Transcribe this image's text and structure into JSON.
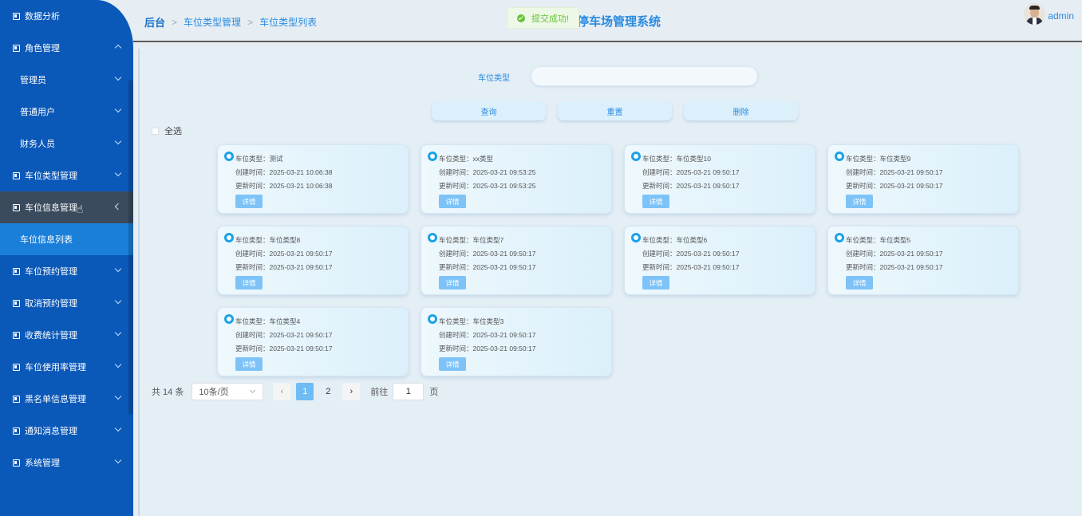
{
  "sidebar": {
    "items": [
      {
        "label": "数据分析",
        "kind": "top",
        "chevron": "none"
      },
      {
        "label": "角色管理",
        "kind": "top",
        "chevron": "up"
      },
      {
        "label": "管理员",
        "kind": "sub",
        "chevron": "down"
      },
      {
        "label": "普通用户",
        "kind": "sub",
        "chevron": "down"
      },
      {
        "label": "财务人员",
        "kind": "sub",
        "chevron": "down"
      },
      {
        "label": "车位类型管理",
        "kind": "top",
        "chevron": "down"
      },
      {
        "label": "车位信息管理",
        "kind": "top-dark",
        "chevron": "left"
      },
      {
        "label": "车位信息列表",
        "kind": "active-sub",
        "chevron": "none"
      },
      {
        "label": "车位预约管理",
        "kind": "top",
        "chevron": "down"
      },
      {
        "label": "取消预约管理",
        "kind": "top",
        "chevron": "down"
      },
      {
        "label": "收费统计管理",
        "kind": "top",
        "chevron": "down"
      },
      {
        "label": "车位使用率管理",
        "kind": "top",
        "chevron": "down"
      },
      {
        "label": "黑名单信息管理",
        "kind": "top",
        "chevron": "down"
      },
      {
        "label": "通知消息管理",
        "kind": "top",
        "chevron": "down"
      },
      {
        "label": "系统管理",
        "kind": "top",
        "chevron": "down"
      }
    ]
  },
  "header": {
    "breadcrumb": [
      "后台",
      "车位类型管理",
      "车位类型列表"
    ],
    "system_title": "停车场管理系统",
    "toast": "提交成功!",
    "username": "admin"
  },
  "search": {
    "label": "车位类型",
    "value": "",
    "placeholder": ""
  },
  "buttons": {
    "query": "查询",
    "reset": "重置",
    "delete": "删除"
  },
  "select_all": "全选",
  "card_labels": {
    "type": "车位类型：",
    "created": "创建时间：",
    "updated": "更新时间：",
    "detail": "详情"
  },
  "cards": [
    {
      "type": "测试",
      "created": "2025-03-21 10:06:38",
      "updated": "2025-03-21 10:06:38"
    },
    {
      "type": "xx类型",
      "created": "2025-03-21 09:53:25",
      "updated": "2025-03-21 09:53:25"
    },
    {
      "type": "车位类型10",
      "created": "2025-03-21 09:50:17",
      "updated": "2025-03-21 09:50:17"
    },
    {
      "type": "车位类型9",
      "created": "2025-03-21 09:50:17",
      "updated": "2025-03-21 09:50:17"
    },
    {
      "type": "车位类型8",
      "created": "2025-03-21 09:50:17",
      "updated": "2025-03-21 09:50:17"
    },
    {
      "type": "车位类型7",
      "created": "2025-03-21 09:50:17",
      "updated": "2025-03-21 09:50:17"
    },
    {
      "type": "车位类型6",
      "created": "2025-03-21 09:50:17",
      "updated": "2025-03-21 09:50:17"
    },
    {
      "type": "车位类型5",
      "created": "2025-03-21 09:50:17",
      "updated": "2025-03-21 09:50:17"
    },
    {
      "type": "车位类型4",
      "created": "2025-03-21 09:50:17",
      "updated": "2025-03-21 09:50:17"
    },
    {
      "type": "车位类型3",
      "created": "2025-03-21 09:50:17",
      "updated": "2025-03-21 09:50:17"
    }
  ],
  "pagination": {
    "total": "共 14 条",
    "page_size": "10条/页",
    "pages": [
      "1",
      "2"
    ],
    "current": "1",
    "goto_label": "前往",
    "goto_value": "1",
    "page_suffix": "页",
    "prev_icon": "chevron-left-icon",
    "next_icon": "chevron-right-icon"
  },
  "colors": {
    "sidebar": "#0a58b8",
    "accent": "#2a8be0",
    "success": "#67c23a",
    "active_page": "#6fbcf5"
  }
}
